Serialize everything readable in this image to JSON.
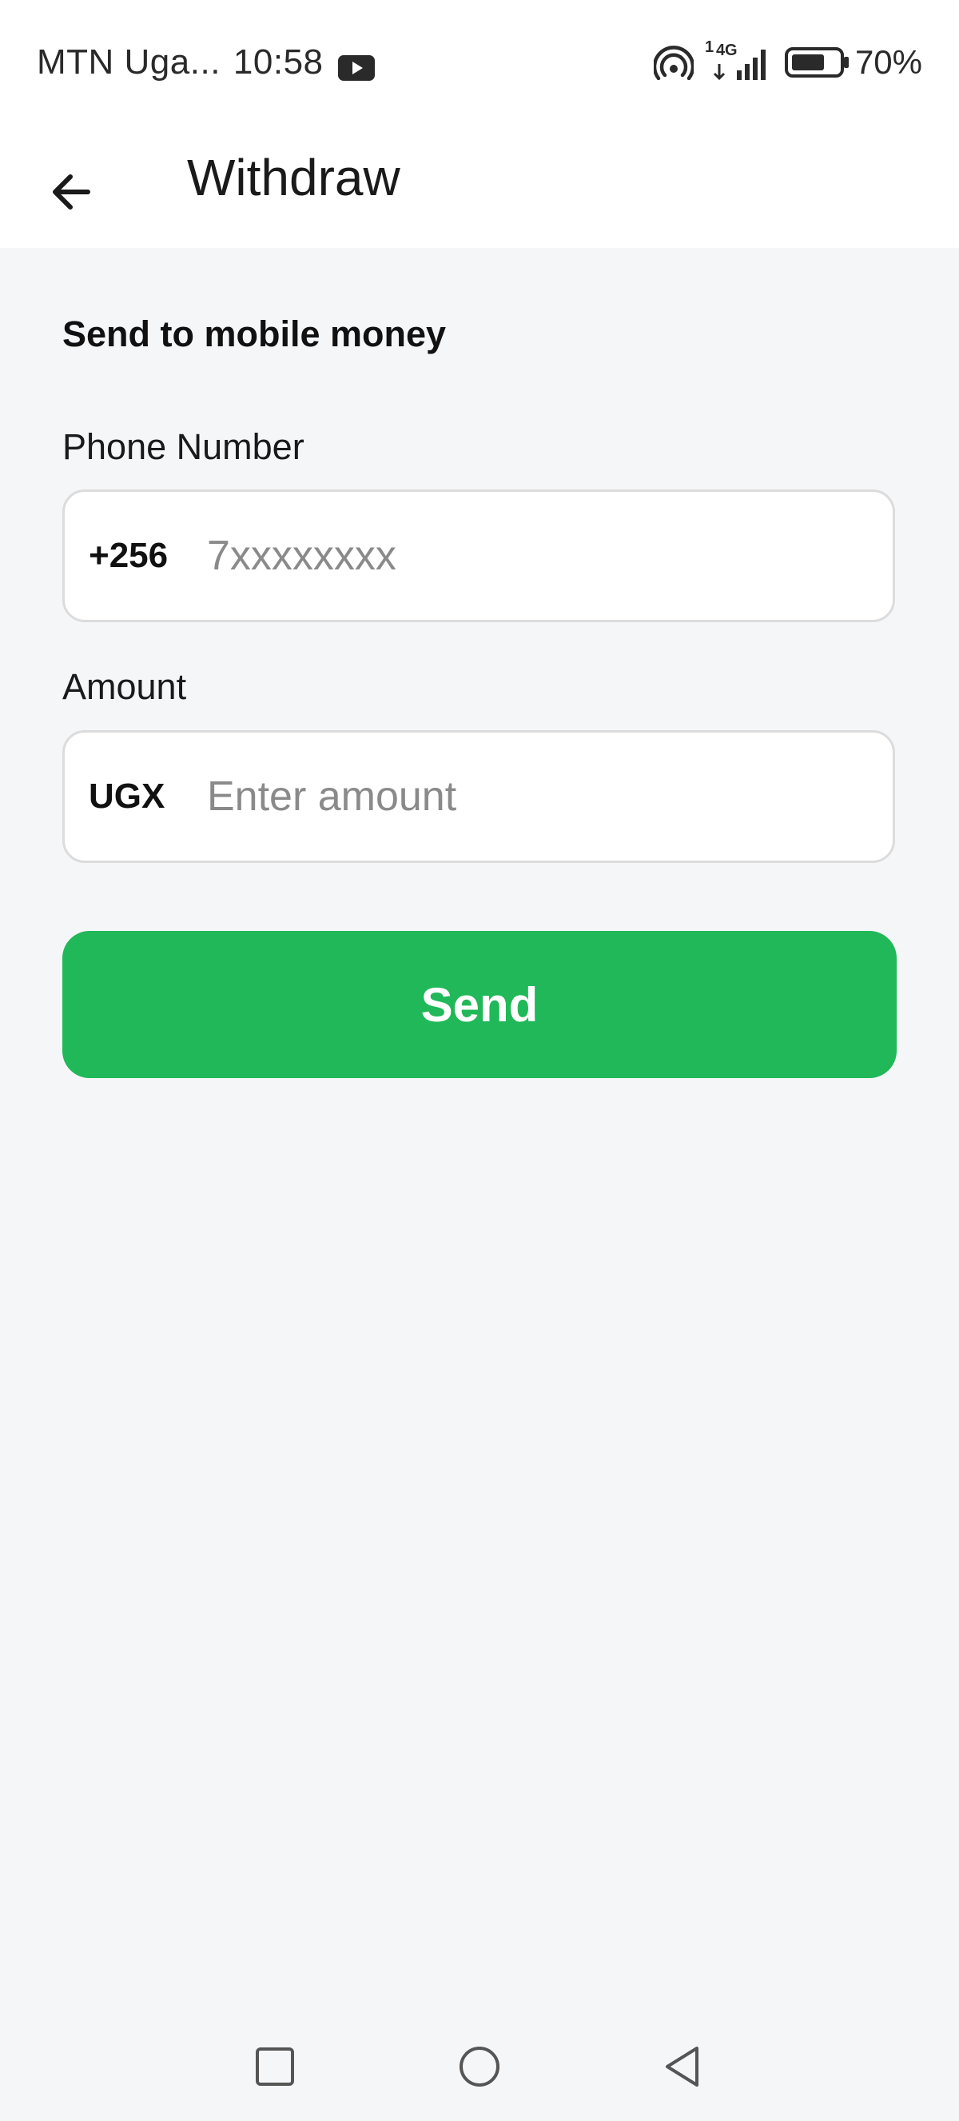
{
  "status_bar": {
    "carrier": "MTN Uga...",
    "time": "10:58",
    "battery_percent": "70%",
    "network_label": "4G",
    "sim_slot": "1",
    "icons": [
      "youtube-notification-icon",
      "hotspot-icon",
      "signal-icon",
      "battery-icon"
    ]
  },
  "app_bar": {
    "title": "Withdraw",
    "back_icon": "arrow-left-icon"
  },
  "form": {
    "section_title": "Send to mobile money",
    "phone": {
      "label": "Phone Number",
      "prefix": "+256",
      "placeholder": "7xxxxxxxx",
      "value": ""
    },
    "amount": {
      "label": "Amount",
      "prefix": "UGX",
      "placeholder": "Enter amount",
      "value": ""
    },
    "send_label": "Send"
  },
  "colors": {
    "accent": "#20b858",
    "background": "#f5f6f8",
    "surface": "#ffffff",
    "border": "#dcdcdc",
    "placeholder": "#8a8a8a"
  },
  "nav_bar": {
    "icons": [
      "recent-apps-icon",
      "home-icon",
      "back-triangle-icon"
    ]
  }
}
